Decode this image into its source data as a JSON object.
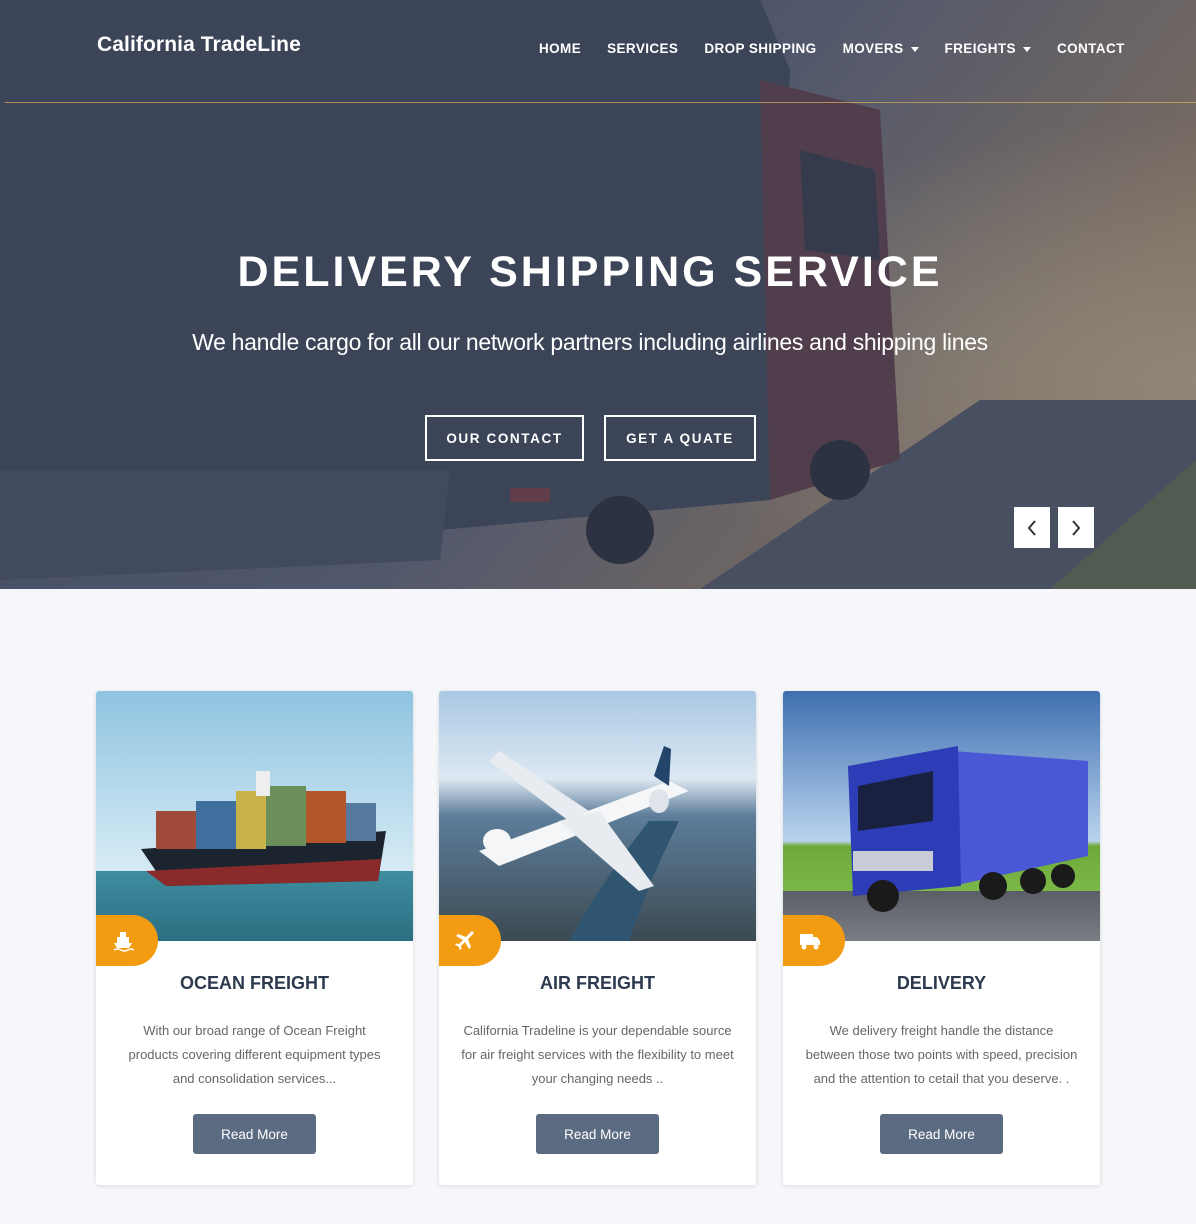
{
  "brand": {
    "logo": "California TradeLine",
    "accent_color": "#f39c12",
    "button_color": "#5b6b82"
  },
  "nav": {
    "items": [
      {
        "label": "HOME",
        "has_dropdown": false
      },
      {
        "label": "SERVICES",
        "has_dropdown": false
      },
      {
        "label": "DROP SHIPPING",
        "has_dropdown": false
      },
      {
        "label": "MOVERS",
        "has_dropdown": true
      },
      {
        "label": "FREIGHTS",
        "has_dropdown": true
      },
      {
        "label": "CONTACT",
        "has_dropdown": false
      }
    ]
  },
  "hero": {
    "title": "DELIVERY SHIPPING SERVICE",
    "subtitle": "We handle cargo for all our network partners including airlines and shipping lines",
    "buttons": {
      "contact": "OUR CONTACT",
      "quote": "GET A QUATE"
    },
    "prev_icon": "chevron-left-icon",
    "next_icon": "chevron-right-icon"
  },
  "services": [
    {
      "title": "OCEAN FREIGHT",
      "text": "With our broad range of Ocean Freight products covering different equipment types and consolidation services...",
      "button": "Read More",
      "icon": "ship-icon"
    },
    {
      "title": "AIR FREIGHT",
      "text": "California Tradeline is your dependable source for air freight services with the flexibility to meet your changing needs ..",
      "button": "Read More",
      "icon": "plane-icon"
    },
    {
      "title": "DELIVERY",
      "text": "We delivery freight handle the distance between those two points with speed, precision and the attention to cetail that you deserve. .",
      "button": "Read More",
      "icon": "truck-icon"
    }
  ]
}
